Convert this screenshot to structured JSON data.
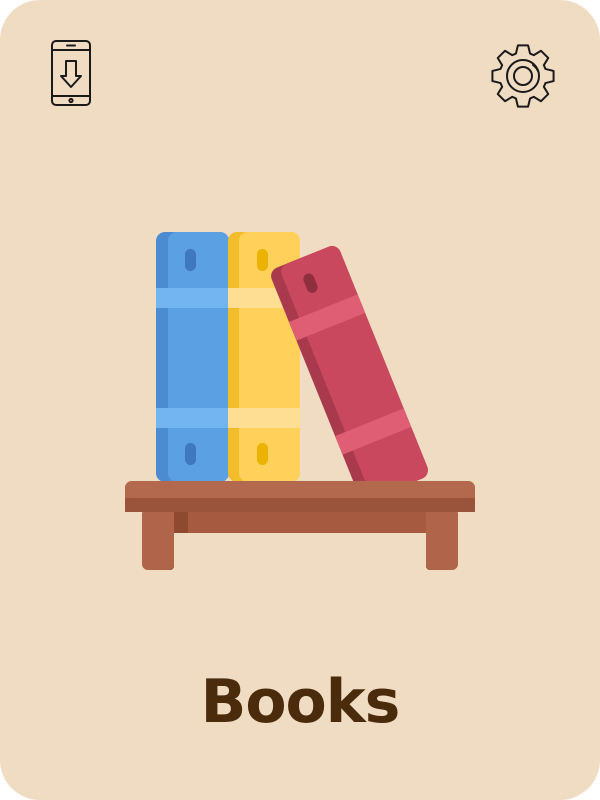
{
  "card": {
    "title": "Books",
    "background_color": "#F0DCC3",
    "title_color": "#4A2C0C"
  },
  "toolbar": {
    "download_icon": "phone-download-icon",
    "settings_icon": "gear-icon"
  },
  "illustration": {
    "icon": "books-on-shelf-icon",
    "colors": {
      "blue_book": "#5AA0E2",
      "yellow_book": "#FFD15A",
      "red_book": "#C9485E",
      "shelf": "#B0654A"
    }
  }
}
